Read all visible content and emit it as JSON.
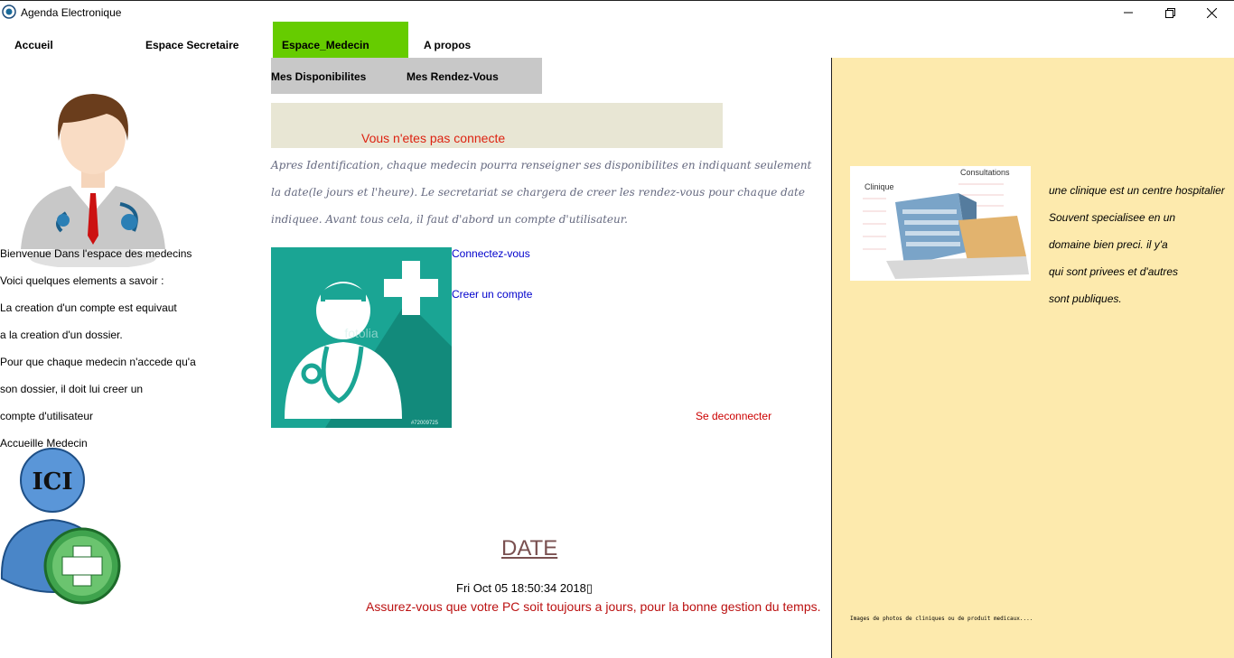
{
  "window": {
    "title": "Agenda Electronique",
    "controls": {
      "minimize": "—",
      "maximize": "❐",
      "close": "✕"
    }
  },
  "menu": {
    "accueil": "Accueil",
    "secretaire": "Espace Secretaire",
    "medecin": "Espace_Medecin",
    "apropos": "A propos",
    "active_color": "#66cc00"
  },
  "submenu": {
    "disponibilites": "Mes Disponibilites",
    "rendez_vous": "Mes Rendez-Vous"
  },
  "left": {
    "lines": [
      "Bienvenue Dans l'espace des medecins",
      "Voici quelques elements a savoir :",
      " La creation d'un compte est equivaut",
      "a la creation d'un dossier.",
      "Pour que chaque medecin n'accede qu'a",
      "son dossier, il doit lui creer un",
      "compte d'utilisateur",
      "Accueille Medecin"
    ],
    "ici_label": "ICI"
  },
  "center": {
    "status": "Vous n'etes pas connecte",
    "intro_lines": [
      "Apres Identification, chaque medecin pourra renseigner ses disponibilites en indiquant seulement",
      " la date(le jours et l'heure). Le secretariat se chargera de creer les rendez-vous pour chaque date",
      "  indiquee. Avant tous cela, il faut d'abord un compte d'utilisateur."
    ],
    "image_watermark": "fotolia",
    "image_id": "#72009725",
    "connect_link": "Connectez-vous",
    "create_link": "Creer un compte",
    "logout_link": "Se deconnecter",
    "date_title": "DATE",
    "date_value": "Fri Oct 05 18:50:34 2018▯",
    "date_warning": "Assurez-vous que votre PC soit toujours a jours, pour la bonne gestion du temps."
  },
  "right": {
    "lines": [
      "une clinique est un centre hospitalier",
      "Souvent specialisee en un",
      "domaine bien preci. il y'a",
      "qui sont privees et d'autres",
      " sont publiques."
    ],
    "clinic_label_1": "Clinique",
    "clinic_label_2": "Consultations",
    "caption": "Images de photos de cliniques ou de produit medicaux....",
    "bg_color": "#fdeaad"
  }
}
